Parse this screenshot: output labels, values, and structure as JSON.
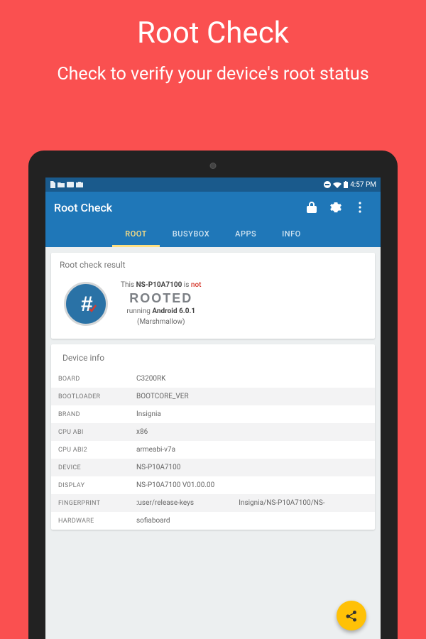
{
  "hero": {
    "title": "Root Check",
    "subtitle": "Check to verify your device's root status"
  },
  "statusbar": {
    "time": "4:57 PM"
  },
  "appbar": {
    "title": "Root Check"
  },
  "tabs": [
    {
      "label": "ROOT",
      "active": true
    },
    {
      "label": "BUSYBOX",
      "active": false
    },
    {
      "label": "APPS",
      "active": false
    },
    {
      "label": "INFO",
      "active": false
    }
  ],
  "result": {
    "card_title": "Root check result",
    "prefix": "This",
    "device_model": "NS-P10A7100",
    "is_word": "is",
    "not_word": "not",
    "rooted_word": "ROOTED",
    "running_prefix": "running",
    "os": "Android 6.0.1",
    "os_name": "(Marshmallow)"
  },
  "device_info": {
    "title": "Device info",
    "rows": [
      {
        "key": "BOARD",
        "val": "C3200RK"
      },
      {
        "key": "BOOTLOADER",
        "val": "BOOTCORE_VER"
      },
      {
        "key": "BRAND",
        "val": "Insignia"
      },
      {
        "key": "CPU ABI",
        "val": "x86"
      },
      {
        "key": "CPU ABI2",
        "val": "armeabi-v7a"
      },
      {
        "key": "DEVICE",
        "val": "NS-P10A7100"
      },
      {
        "key": "DISPLAY",
        "val": "NS-P10A7100 V01.00.00"
      },
      {
        "key": "FINGERPRINT",
        "val": ":user/release-keys",
        "val2": "Insignia/NS-P10A7100/NS-"
      },
      {
        "key": "HARDWARE",
        "val": "sofiaboard"
      }
    ]
  }
}
